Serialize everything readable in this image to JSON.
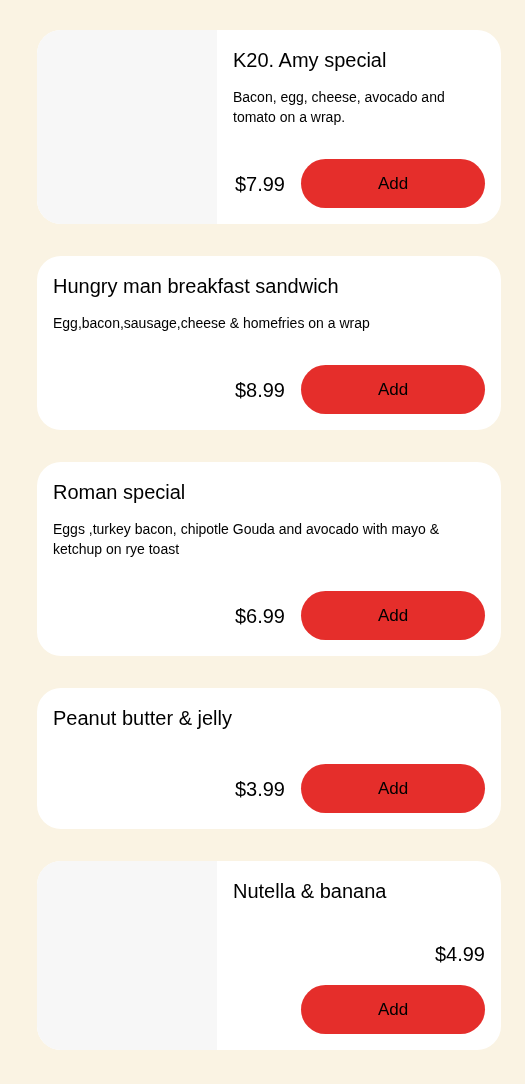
{
  "menu_items": [
    {
      "title": "K20. Amy special",
      "description": "Bacon, egg, cheese, avocado and tomato on a wrap.",
      "price": "$7.99",
      "button": "Add",
      "has_image": true,
      "kind": "inline"
    },
    {
      "title": "Hungry man breakfast sandwich",
      "description": "Egg,bacon,sausage,cheese & homefries on a wrap",
      "price": "$8.99",
      "button": "Add",
      "has_image": false,
      "kind": "inline"
    },
    {
      "title": "Roman special",
      "description": "Eggs ,turkey bacon, chipotle Gouda and avocado with mayo & ketchup on rye toast",
      "price": "$6.99",
      "button": "Add",
      "has_image": false,
      "kind": "inline"
    },
    {
      "title": "Peanut butter & jelly",
      "price": "$3.99",
      "button": "Add",
      "has_image": false,
      "kind": "inline"
    },
    {
      "title": "Nutella & banana",
      "price": "$4.99",
      "button": "Add",
      "has_image": true,
      "kind": "stacked"
    }
  ]
}
